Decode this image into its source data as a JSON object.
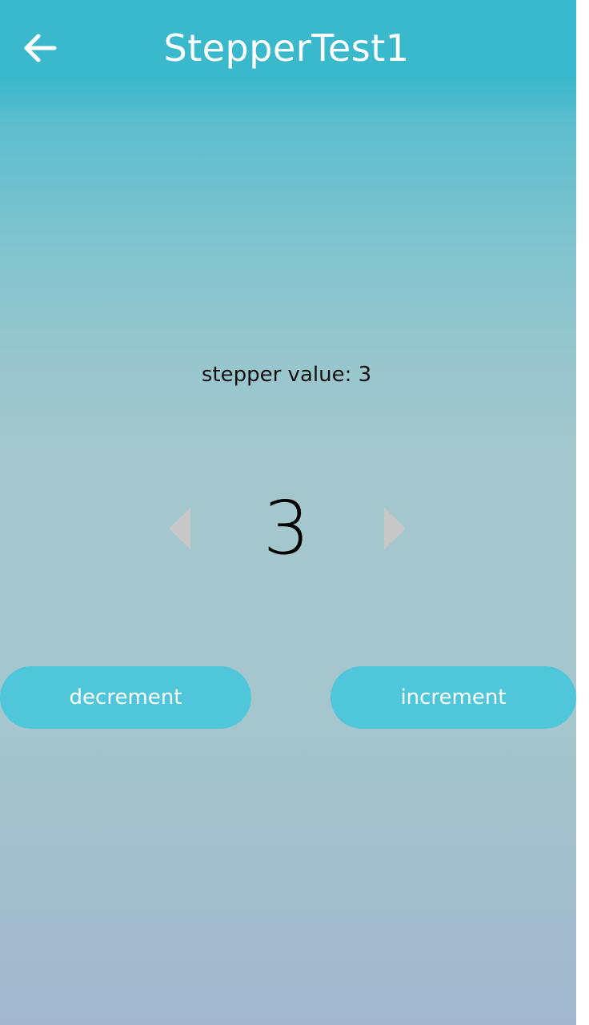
{
  "header": {
    "title": "StepperTest1",
    "back_icon": "arrow-left-icon"
  },
  "main": {
    "value_label": "stepper value: 3",
    "stepper": {
      "value": "3",
      "prev_icon": "triangle-left-icon",
      "next_icon": "triangle-right-icon"
    },
    "decrement_label": "decrement",
    "increment_label": "increment"
  },
  "colors": {
    "header_bg": "#3bb9cc",
    "button_bg": "#4fc6d9",
    "arrow_disabled": "#c8c8c8",
    "text_primary": "#111111"
  }
}
